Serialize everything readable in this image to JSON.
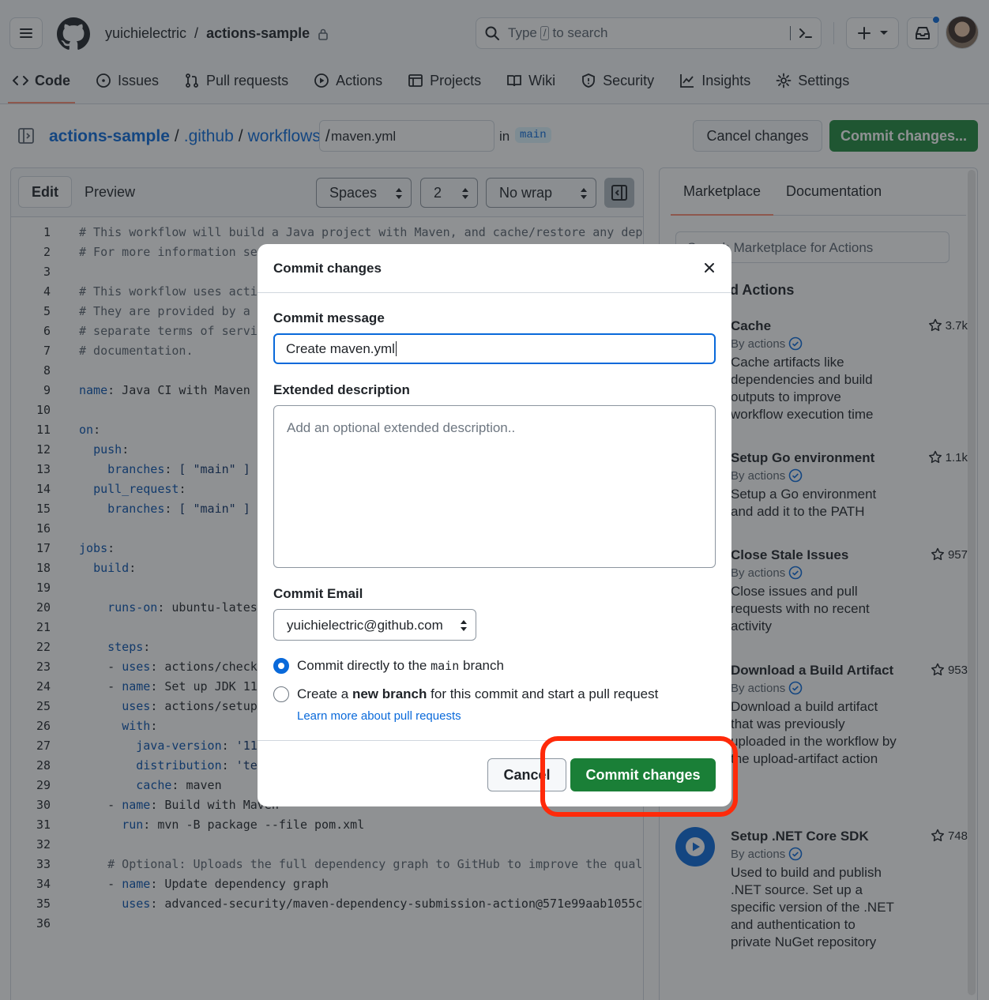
{
  "header": {
    "owner": "yuichielectric",
    "separator": "/",
    "repo": "actions-sample",
    "search_prefix": "Type",
    "search_key": "/",
    "search_suffix": "to search"
  },
  "nav": {
    "tabs": [
      {
        "label": "Code",
        "icon": "code-icon"
      },
      {
        "label": "Issues",
        "icon": "issue-icon"
      },
      {
        "label": "Pull requests",
        "icon": "pull-request-icon"
      },
      {
        "label": "Actions",
        "icon": "play-icon"
      },
      {
        "label": "Projects",
        "icon": "table-icon"
      },
      {
        "label": "Wiki",
        "icon": "book-icon"
      },
      {
        "label": "Security",
        "icon": "shield-icon"
      },
      {
        "label": "Insights",
        "icon": "graph-icon"
      },
      {
        "label": "Settings",
        "icon": "gear-icon"
      }
    ]
  },
  "path": {
    "repo": "actions-sample",
    "dir1": ".github",
    "dir2": "workflows",
    "sep": "/",
    "filename": "maven.yml",
    "in": "in",
    "branch": "main"
  },
  "actions_bar": {
    "cancel": "Cancel changes",
    "commit": "Commit changes..."
  },
  "editor": {
    "edit_tab": "Edit",
    "preview_tab": "Preview",
    "indent_mode": "Spaces",
    "indent_size": "2",
    "wrap_mode": "No wrap",
    "line_numbers": [
      "1",
      "2",
      "3",
      "4",
      "5",
      "6",
      "7",
      "8",
      "9",
      "10",
      "11",
      "12",
      "13",
      "14",
      "15",
      "16",
      "17",
      "18",
      "19",
      "20",
      "21",
      "22",
      "23",
      "24",
      "25",
      "26",
      "27",
      "28",
      "29",
      "30",
      "31",
      "32",
      "33",
      "34",
      "35",
      "36"
    ],
    "lines": [
      "# This workflow will build a Java project with Maven, and cache/restore any dep",
      "# For more information se",
      "",
      "# This workflow uses acti",
      "# They are provided by a",
      "# separate terms of servi",
      "# documentation.",
      "",
      "name: Java CI with Maven",
      "",
      "on:",
      "  push:",
      "    branches: [ \"main\" ]",
      "  pull_request:",
      "    branches: [ \"main\" ]",
      "",
      "jobs:",
      "  build:",
      "",
      "    runs-on: ubuntu-lates",
      "",
      "    steps:",
      "    - uses: actions/check",
      "    - name: Set up JDK 11",
      "      uses: actions/setup",
      "      with:",
      "        java-version: '11",
      "        distribution: 'te",
      "        cache: maven",
      "    - name: Build with Maven",
      "      run: mvn -B package --file pom.xml",
      "",
      "    # Optional: Uploads the full dependency graph to GitHub to improve the qual",
      "    - name: Update dependency graph",
      "      uses: advanced-security/maven-dependency-submission-action@571e99aab1055c",
      ""
    ]
  },
  "sidebar": {
    "tab_marketplace": "Marketplace",
    "tab_docs": "Documentation",
    "search_placeholder": "Search Marketplace for Actions",
    "heading": "Featured Actions",
    "actions": [
      {
        "name": "Cache",
        "by": "By actions",
        "stars": "3.7k",
        "desc": "Cache artifacts like dependencies and build outputs to improve workflow execution time"
      },
      {
        "name": "Setup Go environment",
        "by": "By actions",
        "stars": "1.1k",
        "desc": "Setup a Go environment and add it to the PATH"
      },
      {
        "name": "Close Stale Issues",
        "by": "By actions",
        "stars": "957",
        "desc": "Close issues and pull requests with no recent activity"
      },
      {
        "name": "Download a Build Artifact",
        "by": "By actions",
        "stars": "953",
        "desc": "Download a build artifact that was previously uploaded in the workflow by the upload-artifact action"
      },
      {
        "name": "Setup .NET Core SDK",
        "by": "By actions",
        "stars": "748",
        "desc": "Used to build and publish .NET source. Set up a specific version of the .NET and authentication to private NuGet repository"
      }
    ]
  },
  "modal": {
    "title": "Commit changes",
    "message_label": "Commit message",
    "message_value": "Create maven.yml",
    "desc_label": "Extended description",
    "desc_placeholder": "Add an optional extended description..",
    "email_label": "Commit Email",
    "email_value": "yuichielectric@github.com",
    "radio1_pre": "Commit directly to the",
    "radio1_branch": "main",
    "radio1_post": "branch",
    "radio2_pre": "Create a",
    "radio2_bold": "new branch",
    "radio2_post": "for this commit and start a pull request",
    "learn_more": "Learn more about pull requests",
    "cancel": "Cancel",
    "commit": "Commit changes"
  },
  "colors": {
    "accent": "#0969da",
    "primary_button": "#1f883d",
    "highlight": "#ff2a0a"
  }
}
